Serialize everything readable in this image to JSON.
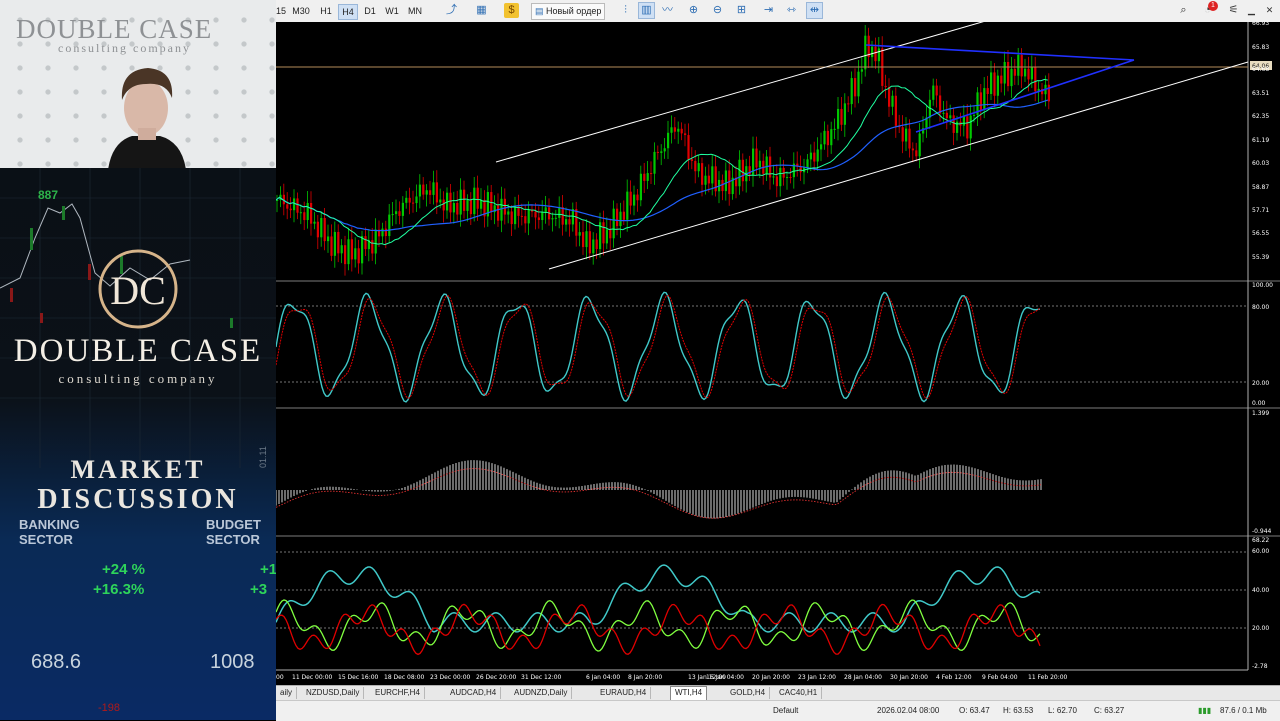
{
  "overlay": {
    "webcam_brand": "DOUBLE CASE",
    "webcam_sub": "consulting company",
    "logo_title": "DOUBLE CASE",
    "logo_sub": "consulting company",
    "market_line1": "MARKET",
    "market_line2": "DISCUSSION",
    "banking_sector": "BANKING SECTOR",
    "budget_sector": "BUDGET SECTOR",
    "pct1": "+24 %",
    "pct2": "+16.3%",
    "pct3": "+1",
    "pct4": "+3",
    "value1": "688.6",
    "value2": "1008",
    "bg_num": "887",
    "bg_red": "-198",
    "bg_side": "01.11"
  },
  "toolbar": {
    "timeframes": [
      "15",
      "M30",
      "H1",
      "H4",
      "D1",
      "W1",
      "MN"
    ],
    "active_timeframe": "H4",
    "new_order": "Новый ордер",
    "notification_count": "1"
  },
  "chart": {
    "symbol": "WTI,H4",
    "price_axis": [
      "66.93",
      "65.83",
      "64.68",
      "63.51",
      "62.35",
      "61.19",
      "60.03",
      "58.87",
      "57.71",
      "56.55",
      "55.39"
    ],
    "current_price": "64.06",
    "x_labels": [
      "00",
      "11 Dec 00:00",
      "15 Dec 16:00",
      "18 Dec 08:00",
      "23 Dec 00:00",
      "26 Dec 20:00",
      "31 Dec 12:00",
      "6 Jan 04:00",
      "8 Jan 20:00",
      "13 Jan 12:00",
      "16 Jan 04:00",
      "20 Jan 20:00",
      "23 Jan 12:00",
      "28 Jan 04:00",
      "30 Jan 20:00",
      "4 Feb 12:00",
      "9 Feb 04:00",
      "11 Feb 20:00"
    ],
    "stoch_axis": [
      "100.00",
      "80.00",
      "20.00",
      "0.00"
    ],
    "macd_axis": [
      "1.399",
      "-0.944"
    ],
    "adx_axis": [
      "68.22",
      "60.00",
      "40.00",
      "20.00",
      "-2.78"
    ],
    "colors": {
      "bull": "#00c800",
      "bear": "#e00000",
      "ma1": "#2060ff",
      "ma2": "#20ffa0",
      "channel": "#ffffff",
      "cyan": "#40c8c8",
      "green": "#80ff40",
      "red": "#e00000"
    }
  },
  "tabs": [
    "aily",
    "NZDUSD,Daily",
    "EURCHF,H4",
    "AUDCAD,H4",
    "AUDNZD,Daily",
    "EURAUD,H4",
    "WTI,H4",
    "GOLD,H4",
    "CAC40,H1"
  ],
  "active_tab": "WTI,H4",
  "status": {
    "profile": "Default",
    "datetime": "2026.02.04 08:00",
    "open": "O: 63.47",
    "high": "H: 63.53",
    "low": "L: 62.70",
    "close": "C: 63.27",
    "traffic": "87.6 / 0.1 Mb"
  }
}
